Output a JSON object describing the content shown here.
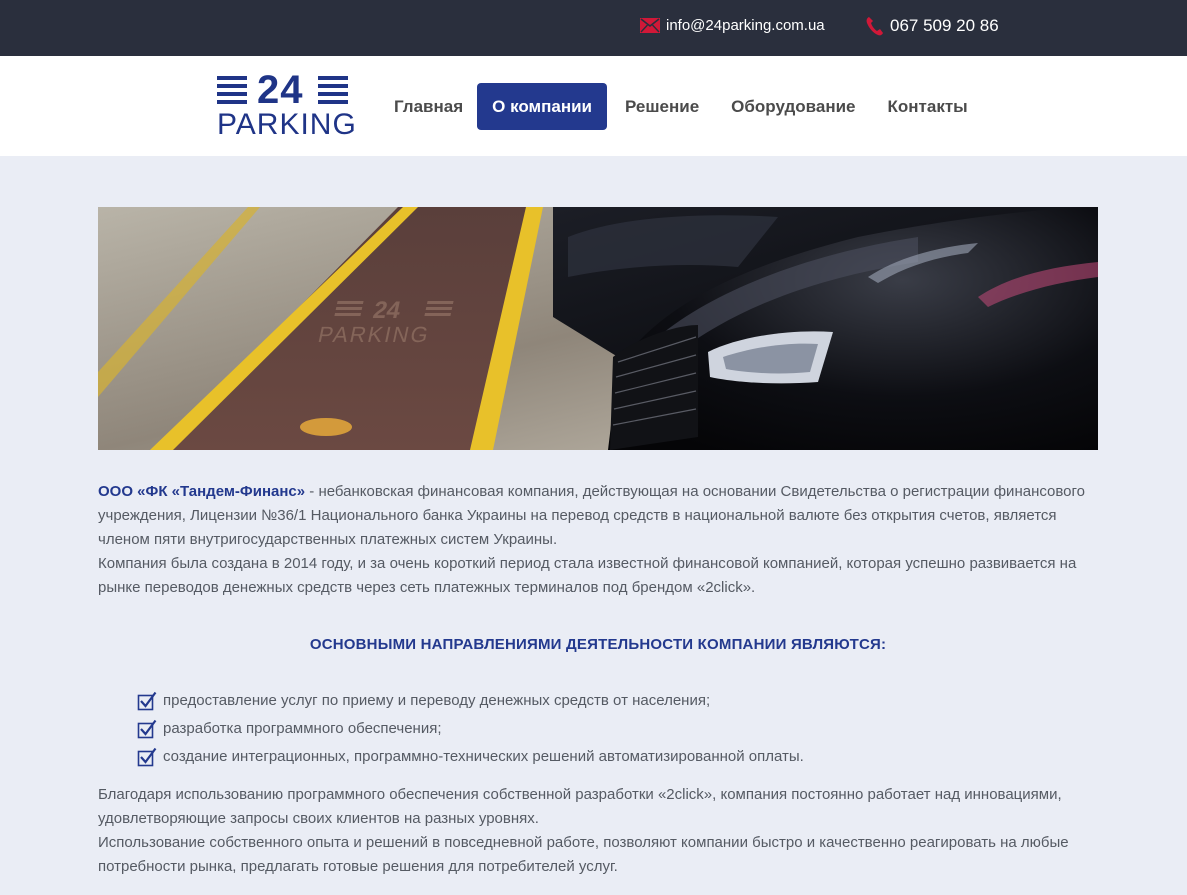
{
  "topbar": {
    "email": "info@24parking.com.ua",
    "phone": "067 509 20 86",
    "icon_color": "#d11838"
  },
  "logo": {
    "number": "24",
    "word": "PARKING"
  },
  "nav": {
    "items": [
      {
        "label": "Главная",
        "active": false
      },
      {
        "label": "О компании",
        "active": true
      },
      {
        "label": "Решение",
        "active": false
      },
      {
        "label": "Оборудование",
        "active": false
      },
      {
        "label": "Контакты",
        "active": false
      }
    ]
  },
  "hero": {
    "floor_text_number": "24",
    "floor_text_word": "PARKING"
  },
  "content": {
    "company_name": "ООО «ФК «Тандем-Финанс»",
    "intro_rest": " - небанковская финансовая компания, действующая на основании Свидетельства о регистрации финансового учреждения, Лицензии №36/1 Национального банка Украины на перевод средств в национальной валюте без открытия счетов, является членом пяти внутригосударственных платежных систем Украины.",
    "intro_2": "Компания была создана в 2014 году, и за очень короткий период стала известной финансовой компанией, которая успешно развивается на рынке переводов денежных средств через сеть платежных терминалов под брендом «2click».",
    "heading": "ОСНОВНЫМИ НАПРАВЛЕНИЯМИ ДЕЯТЕЛЬНОСТИ КОМПАНИИ ЯВЛЯЮТСЯ:",
    "list": [
      "предоставление услуг по приему и переводу денежных средств от населения;",
      "разработка программного обеспечения;",
      "создание интеграционных, программно-технических решений автоматизированной оплаты."
    ],
    "outro_1": "Благодаря использованию программного обеспечения собственной разработки «2click», компания постоянно работает над инновациями, удовлетворяющие запросы своих клиентов на разных уровнях.",
    "outro_2": "Использование собственного опыта и решений в повседневной работе, позволяют компании быстро и качественно реагировать на любые потребности рынка, предлагать готовые решения для потребителей услуг."
  },
  "colors": {
    "brand_blue": "#23398e",
    "topbar_bg": "#2a2f3d",
    "page_bg": "#eaedf5"
  }
}
